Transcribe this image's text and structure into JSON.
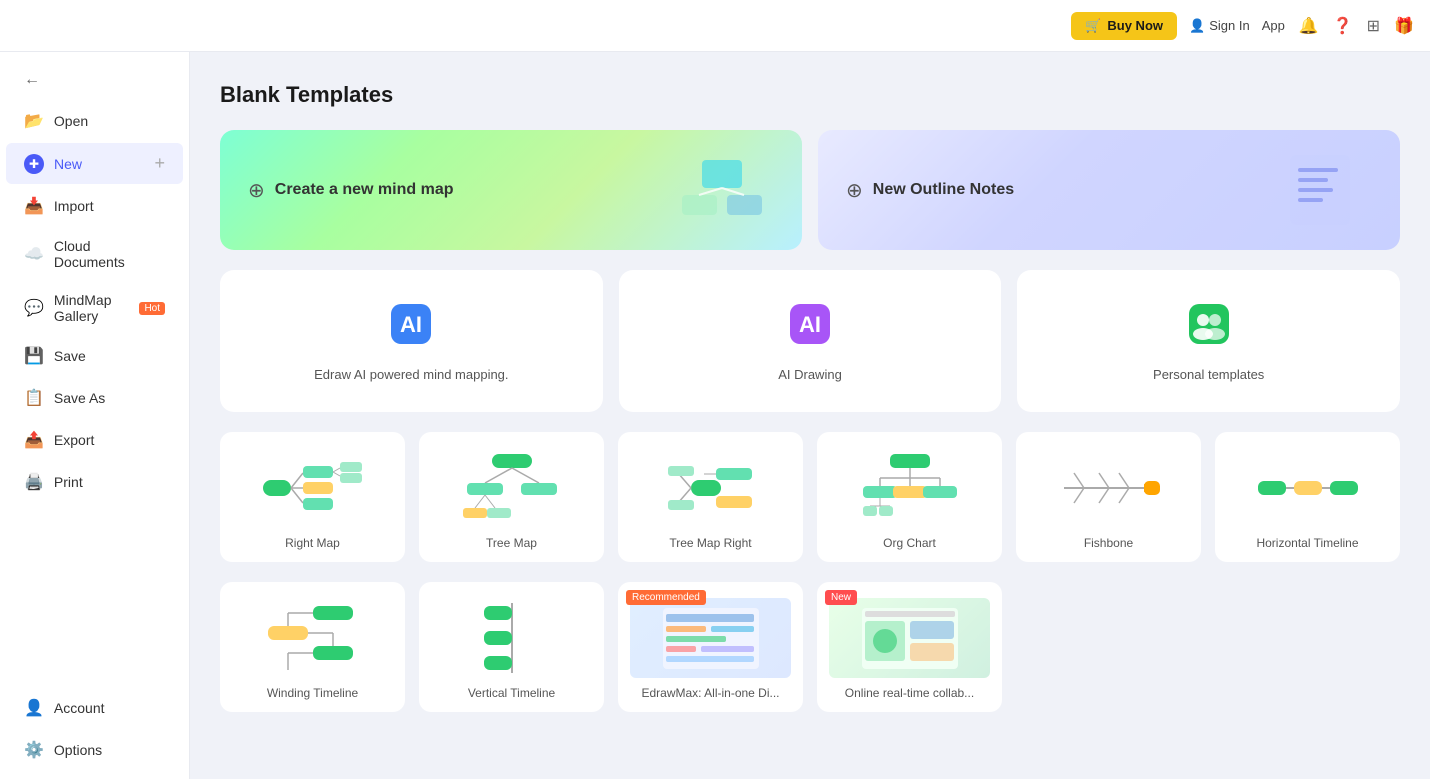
{
  "topbar": {
    "buy_now": "Buy Now",
    "sign_in": "Sign In",
    "app_label": "App"
  },
  "sidebar": {
    "back_label": "←",
    "items": [
      {
        "id": "open",
        "label": "Open",
        "icon": "📂"
      },
      {
        "id": "new",
        "label": "New",
        "icon": "✚",
        "active": true
      },
      {
        "id": "import",
        "label": "Import",
        "icon": "📥"
      },
      {
        "id": "cloud",
        "label": "Cloud Documents",
        "icon": "☁️"
      },
      {
        "id": "gallery",
        "label": "MindMap Gallery",
        "icon": "💬",
        "badge": "Hot"
      },
      {
        "id": "save",
        "label": "Save",
        "icon": "💾"
      },
      {
        "id": "saveas",
        "label": "Save As",
        "icon": "📋"
      },
      {
        "id": "export",
        "label": "Export",
        "icon": "📤"
      },
      {
        "id": "print",
        "label": "Print",
        "icon": "🖨️"
      }
    ],
    "bottom": [
      {
        "id": "account",
        "label": "Account",
        "icon": "👤"
      },
      {
        "id": "options",
        "label": "Options",
        "icon": "⚙️"
      }
    ]
  },
  "main": {
    "page_title": "Blank Templates",
    "hero_cards": [
      {
        "id": "new-mind-map",
        "label": "Create a new mind map",
        "style": "green"
      },
      {
        "id": "new-outline",
        "label": "New Outline Notes",
        "style": "purple"
      }
    ],
    "feature_cards": [
      {
        "id": "ai-mind",
        "label": "Edraw AI powered mind mapping.",
        "icon": "🤖"
      },
      {
        "id": "ai-drawing",
        "label": "AI Drawing",
        "icon": "🎨"
      },
      {
        "id": "personal-templates",
        "label": "Personal templates",
        "icon": "👥"
      }
    ],
    "templates": [
      {
        "id": "right-map",
        "label": "Right Map",
        "type": "right-map"
      },
      {
        "id": "tree-map",
        "label": "Tree Map",
        "type": "tree-map"
      },
      {
        "id": "tree-map-right",
        "label": "Tree Map Right",
        "type": "tree-map-right"
      },
      {
        "id": "org-chart",
        "label": "Org Chart",
        "type": "org-chart"
      },
      {
        "id": "fishbone",
        "label": "Fishbone",
        "type": "fishbone"
      },
      {
        "id": "horizontal-timeline",
        "label": "Horizontal Timeline",
        "type": "h-timeline"
      }
    ],
    "templates_row2": [
      {
        "id": "winding-timeline",
        "label": "Winding Timeline",
        "type": "winding"
      },
      {
        "id": "vertical-timeline",
        "label": "Vertical Timeline",
        "type": "vertical"
      },
      {
        "id": "edrawmax",
        "label": "EdrawMax: All-in-one Di...",
        "type": "screenshot-edraw",
        "badge": "Recommended"
      },
      {
        "id": "online-collab",
        "label": "Online real-time collab...",
        "type": "screenshot-collab",
        "badge": "New"
      }
    ]
  }
}
